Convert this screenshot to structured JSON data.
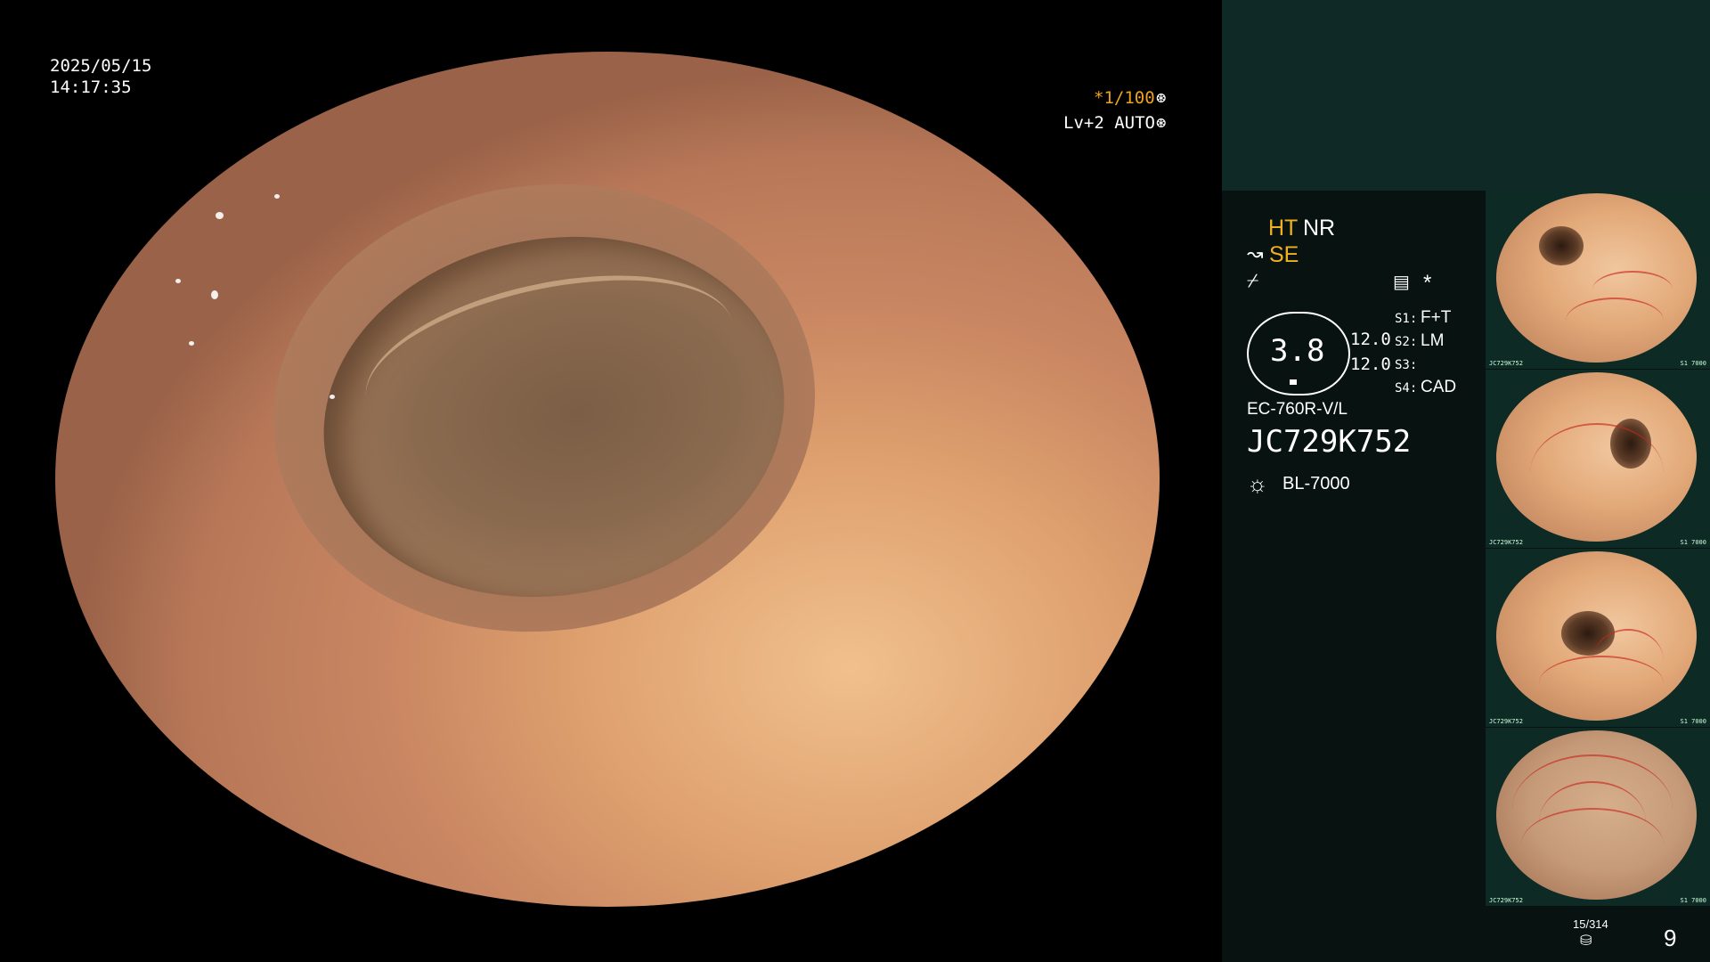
{
  "overlay": {
    "date": "2025/05/15",
    "time": "14:17:35",
    "shutter": "*1/100",
    "level": "Lv+2 AUTO"
  },
  "status": {
    "ht": "HT",
    "nr": "NR",
    "se": "SE",
    "zoom_value": "3.8",
    "val1": "12.0",
    "val2": "12.0",
    "s1_label": "S1:",
    "s1_value": "F+T",
    "s2_label": "S2:",
    "s2_value": "LM",
    "s3_label": "S3:",
    "s3_value": "",
    "s4_label": "S4:",
    "s4_value": "CAD",
    "scope_model": "EC-760R-V/L",
    "scope_serial": "JC729K752",
    "light_source": "BL-7000",
    "storage_count": "15/314",
    "page_number": "9"
  },
  "colors": {
    "panel_bg": "#081211",
    "panel_top": "#0f2a26",
    "accent_orange": "#f0a21e"
  }
}
